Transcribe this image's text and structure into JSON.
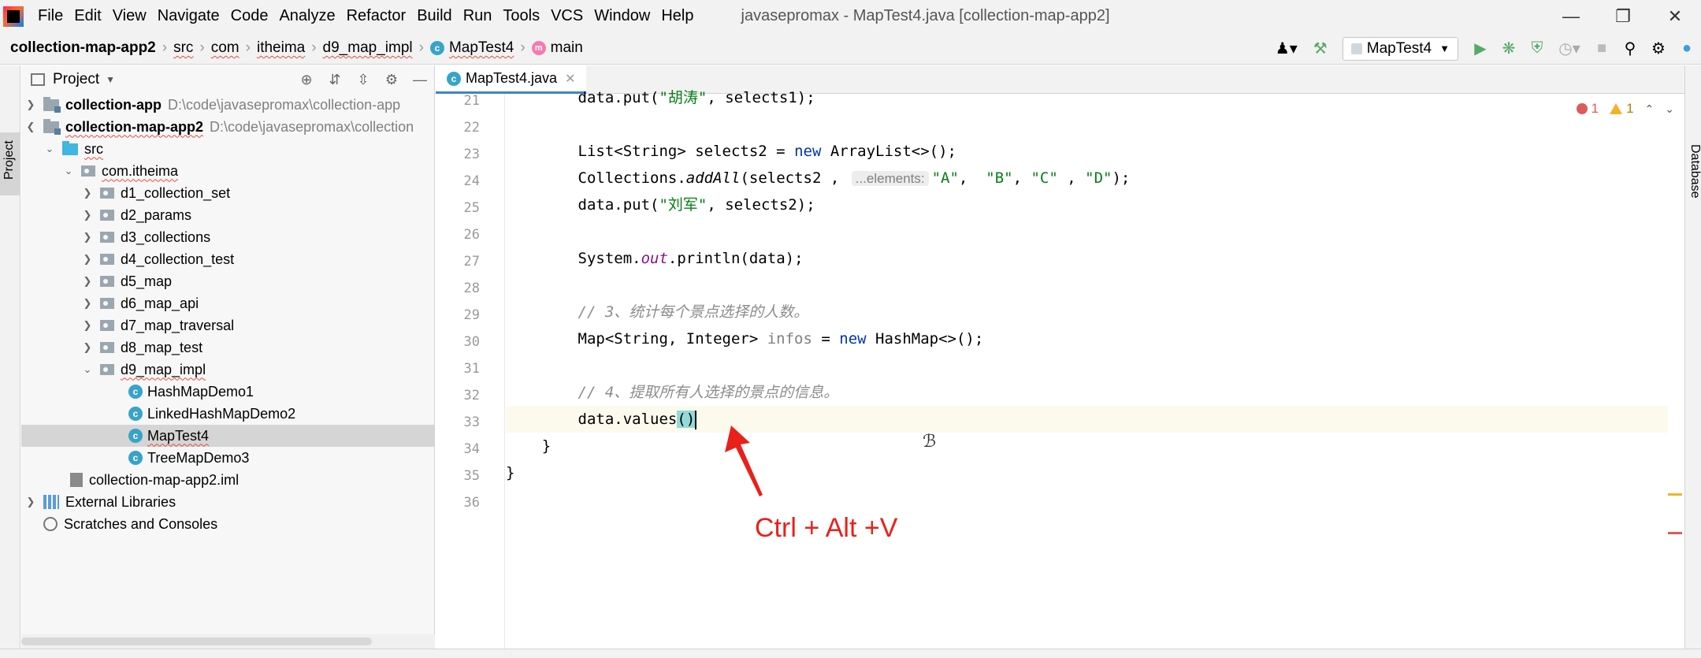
{
  "menubar": {
    "items": [
      "File",
      "Edit",
      "View",
      "Navigate",
      "Code",
      "Analyze",
      "Refactor",
      "Build",
      "Run",
      "Tools",
      "VCS",
      "Window",
      "Help"
    ],
    "window_title": "javasepromax - MapTest4.java [collection-map-app2]"
  },
  "navbar": {
    "crumbs": [
      "collection-map-app2",
      "src",
      "com",
      "itheima",
      "d9_map_impl",
      "MapTest4",
      "main"
    ]
  },
  "toolbar": {
    "run_config": "MapTest4"
  },
  "project": {
    "title": "Project",
    "stripe_label": "Project",
    "tree": [
      {
        "label": "collection-app",
        "hint": "D:\\code\\javasepromax\\collection-app"
      },
      {
        "label": "collection-map-app2",
        "hint": "D:\\code\\javasepromax\\collection"
      },
      {
        "label": "src"
      },
      {
        "label": "com.itheima"
      },
      {
        "label": "d1_collection_set"
      },
      {
        "label": "d2_params"
      },
      {
        "label": "d3_collections"
      },
      {
        "label": "d4_collection_test"
      },
      {
        "label": "d5_map"
      },
      {
        "label": "d6_map_api"
      },
      {
        "label": "d7_map_traversal"
      },
      {
        "label": "d8_map_test"
      },
      {
        "label": "d9_map_impl"
      },
      {
        "label": "HashMapDemo1"
      },
      {
        "label": "LinkedHashMapDemo2"
      },
      {
        "label": "MapTest4"
      },
      {
        "label": "TreeMapDemo3"
      },
      {
        "label": "collection-map-app2.iml"
      },
      {
        "label": "External Libraries"
      },
      {
        "label": "Scratches and Consoles"
      }
    ]
  },
  "editor": {
    "tab": "MapTest4.java",
    "line_numbers": [
      "21",
      "22",
      "23",
      "24",
      "25",
      "26",
      "27",
      "28",
      "29",
      "30",
      "31",
      "32",
      "33",
      "34",
      "35",
      "36"
    ],
    "inspection": {
      "errors": "1",
      "warnings": "1"
    },
    "param_hint": "...elements:",
    "code": {
      "l21a": "data.put(",
      "l21s": "\"胡涛\"",
      "l21b": ", selects1);",
      "l23a": "List<String> selects2 = ",
      "l23k": "new",
      "l23b": " ArrayList<>();",
      "l24a": "Collections.",
      "l24m": "addAll",
      "l24b": "(selects2 , ",
      "l24s1": "\"A\"",
      "l24c1": ",  ",
      "l24s2": "\"B\"",
      "l24c2": ", ",
      "l24s3": "\"C\"",
      "l24c3": " , ",
      "l24s4": "\"D\"",
      "l24e": ");",
      "l25a": "data.put(",
      "l25s": "\"刘军\"",
      "l25b": ", selects2);",
      "l27a": "System.",
      "l27f": "out",
      "l27b": ".println(data);",
      "l29": "// 3、统计每个景点选择的人数。",
      "l30a": "Map<String, Integer> ",
      "l30v": "infos",
      "l30b": " = ",
      "l30k": "new",
      "l30c": " HashMap<>();",
      "l32": "// 4、提取所有人选择的景点的信息。",
      "l33a": "data.values",
      "l33p": "()",
      "l34": "}",
      "l35": "}"
    }
  },
  "right_stripe": {
    "label": "Database"
  },
  "annotation": {
    "text": "Ctrl + Alt +V"
  }
}
